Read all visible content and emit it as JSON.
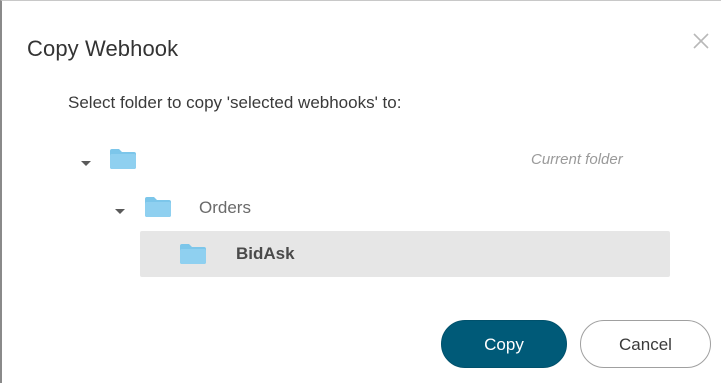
{
  "dialog": {
    "title": "Copy Webhook",
    "close_icon": "close-icon",
    "instruction": "Select folder to copy 'selected webhooks' to:"
  },
  "tree": {
    "root": {
      "label": "",
      "note": "Current folder",
      "expanded": true,
      "icon": "folder-icon"
    },
    "children": [
      {
        "label": "Orders",
        "expanded": true,
        "icon": "folder-icon",
        "children": [
          {
            "label": "BidAsk",
            "selected": true,
            "icon": "folder-icon"
          }
        ]
      }
    ]
  },
  "buttons": {
    "copy": "Copy",
    "cancel": "Cancel"
  },
  "colors": {
    "folder": "#7cc6ea",
    "primary": "#005a78",
    "selected_row": "#e6e6e6"
  }
}
